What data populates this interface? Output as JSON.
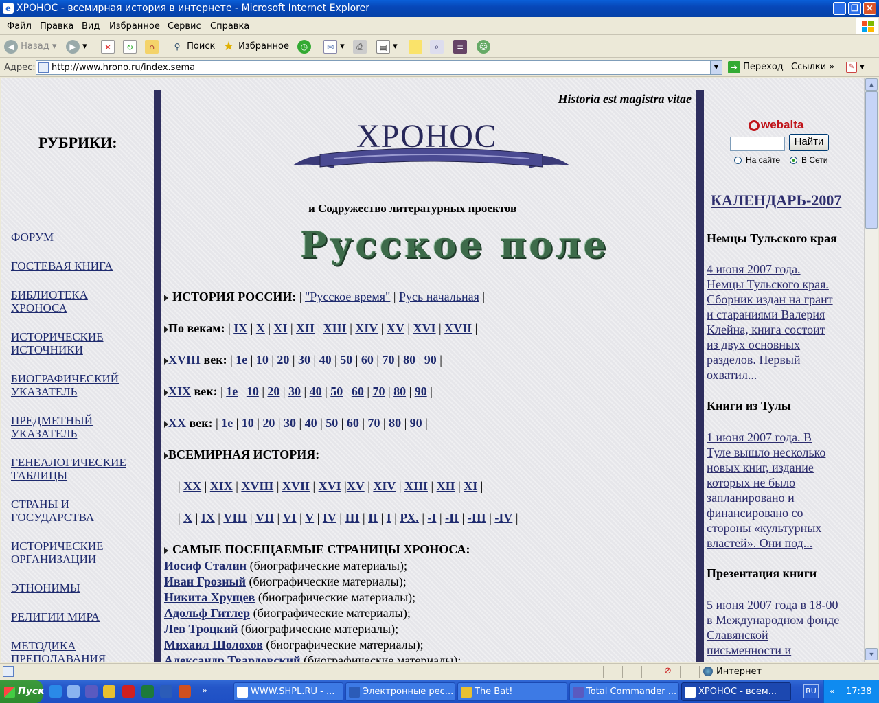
{
  "window": {
    "title": "ХРОНОС - всемирная история в интернете - Microsoft Internet Explorer"
  },
  "menu": [
    "Файл",
    "Правка",
    "Вид",
    "Избранное",
    "Сервис",
    "Справка"
  ],
  "toolbar": {
    "back": "Назад",
    "search": "Поиск",
    "favorites": "Избранное"
  },
  "address": {
    "label": "Адрес:",
    "url": "http://www.hrono.ru/index.sema",
    "go": "Переход",
    "links": "Ссылки"
  },
  "page": {
    "motto": "Historia est magistra vitae",
    "logo": "ХРОНОС",
    "rubrics_title": "РУБРИКИ:",
    "nav": [
      "ФОРУМ",
      "ГОСТЕВАЯ КНИГА",
      "БИБЛИОТЕКА ХРОНОСА",
      "ИСТОРИЧЕСКИЕ ИСТОЧНИКИ",
      "БИОГРАФИЧЕСКИЙ УКАЗАТЕЛЬ",
      "ПРЕДМЕТНЫЙ УКАЗАТЕЛЬ",
      "ГЕНЕАЛОГИЧЕСКИЕ ТАБЛИЦЫ",
      "СТРАНЫ И ГОСУДАРСТВА",
      "ИСТОРИЧЕСКИЕ ОРГАНИЗАЦИИ",
      "ЭТНОНИМЫ",
      "РЕЛИГИИ МИРА",
      "МЕТОДИКА ПРЕПОДАВАНИЯ"
    ],
    "sodruzhestvo": "и Содружество литературных проектов",
    "russkoe_pole": "Русское поле",
    "history_russia": {
      "label": "ИСТОРИЯ РОССИИ:",
      "links": [
        "\"Русское время\"",
        "Русь начальная"
      ]
    },
    "centuries": {
      "label": "По векам:",
      "items": [
        "IX",
        "X",
        "XI",
        "XII",
        "XIII",
        "XIV",
        "XV",
        "XVI",
        "XVII"
      ]
    },
    "decades": [
      "1е",
      "10",
      "20",
      "30",
      "40",
      "50",
      "60",
      "70",
      "80",
      "90"
    ],
    "c18": "XVIII",
    "c19": "XIX",
    "c20": "XX",
    "century_suffix": "век:",
    "world_history": {
      "label": "ВСЕМИРНАЯ ИСТОРИЯ:",
      "row1": [
        "XX",
        "XIX",
        "XVIII",
        "XVII",
        "XVI",
        "XV",
        "XIV",
        "XIII",
        "XII",
        "XI"
      ],
      "row2": [
        "X",
        "IX",
        "VIII",
        "VII",
        "VI",
        "V",
        "IV",
        "III",
        "II",
        "I",
        "РХ.",
        "-I",
        "-II",
        "-III",
        "-IV"
      ]
    },
    "popular": {
      "label": "САМЫЕ ПОСЕЩАЕМЫЕ СТРАНИЦЫ ХРОНОСА:",
      "suffix": "(биографические материалы);",
      "names": [
        "Иосиф Сталин",
        "Иван Грозный",
        "Никита Хрущев",
        "Адольф Гитлер",
        "Лев Троцкий",
        "Михаил Шолохов",
        "Александр Твардовский"
      ]
    },
    "search": {
      "brand": "webalta",
      "button": "Найти",
      "opt_site": "На сайте",
      "opt_web": "В Сети"
    },
    "calendar": "КАЛЕНДАРЬ-2007",
    "news": [
      {
        "title": "Немцы Тульского края",
        "lines": [
          "4 июня 2007 года.",
          "Немцы Тульского края.",
          "Сборник издан на грант",
          "и стараниями Валерия",
          "Клейна, книга состоит",
          "из двух основных",
          "разделов. Первый",
          "охватил..."
        ]
      },
      {
        "title": "Книги из Тулы",
        "lines": [
          "1 июня 2007 года. В",
          "Туле вышло несколько",
          "новых книг, издание",
          "которых не было",
          "запланировано и",
          "финансировано со",
          "стороны «культурных",
          "властей». Они под..."
        ]
      },
      {
        "title": "Презентация книги",
        "lines": [
          "5 июня 2007 года в 18-00",
          "в Международном фонде",
          "Славянской",
          "письменности и"
        ]
      }
    ]
  },
  "status": {
    "zone": "Интернет"
  },
  "taskbar": {
    "start": "Пуск",
    "tasks": [
      "WWW.SHPL.RU - ...",
      "Электронные рес...",
      "The Bat!",
      "Total Commander ...",
      "ХРОНОС - всем..."
    ],
    "lang": "RU",
    "time": "17:38"
  }
}
